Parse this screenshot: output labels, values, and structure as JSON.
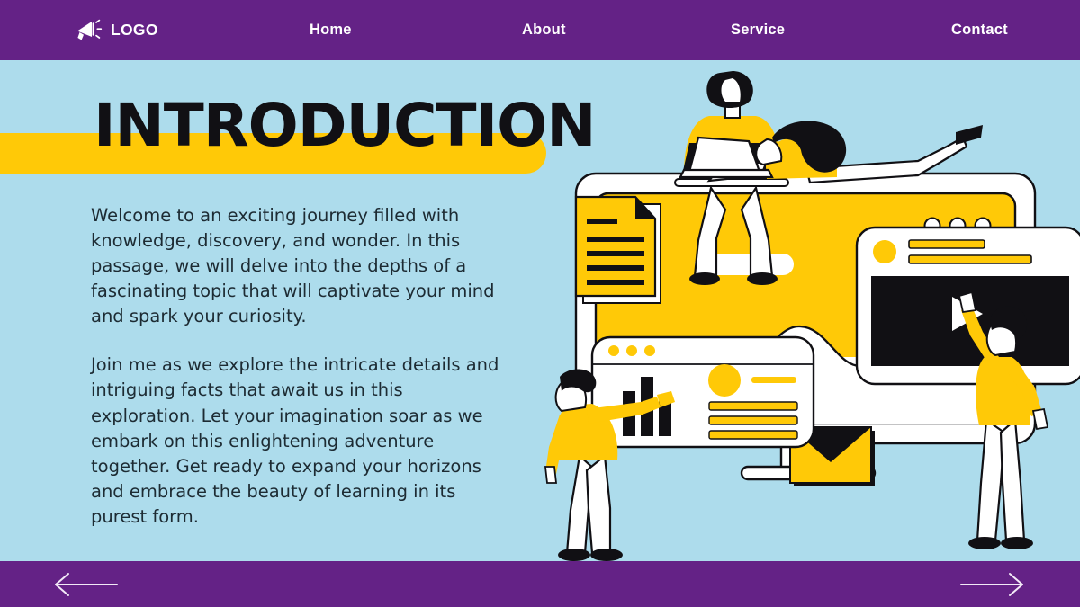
{
  "theme": {
    "purple": "#642286",
    "background_blue": "#addcec",
    "accent_yellow": "#ffc907",
    "ink_black": "#111014",
    "text_dark": "#1d2b33",
    "white": "#ffffff"
  },
  "navbar": {
    "logo": {
      "icon": "megaphone-icon",
      "label": "LOGO"
    },
    "items": [
      {
        "label": "Home"
      },
      {
        "label": "About"
      },
      {
        "label": "Service"
      },
      {
        "label": "Contact"
      }
    ]
  },
  "hero": {
    "title": "INTRODUCTION",
    "paragraphs": [
      "Welcome to an exciting journey filled with knowledge, discovery, and wonder. In this passage, we will delve into the depths of a fascinating topic that will captivate your mind and spark your curiosity.",
      "Join me as we explore the intricate details and intriguing facts that await us in this exploration. Let your imagination soar as we embark on this enlightening adventure together. Get ready to expand your horizons and embrace the beauty of learning in its purest form."
    ]
  },
  "illustration": {
    "description": "Flat-style illustration of people working with a large computer monitor, a video player window, a dashboard window with a bar chart, a document page and an envelope.",
    "elements": [
      {
        "name": "document-page-icon"
      },
      {
        "name": "large-monitor"
      },
      {
        "name": "monitor-wave-chart"
      },
      {
        "name": "monitor-dots"
      },
      {
        "name": "person-sitting-with-laptop"
      },
      {
        "name": "person-lying-with-laptop"
      },
      {
        "name": "video-player-window"
      },
      {
        "name": "play-button-icon"
      },
      {
        "name": "dashboard-window"
      },
      {
        "name": "bar-chart-icon"
      },
      {
        "name": "person-pointing-at-dashboard"
      },
      {
        "name": "person-reaching-up"
      },
      {
        "name": "envelope-icon"
      }
    ]
  },
  "footer": {
    "prev_label": "Previous slide",
    "next_label": "Next slide",
    "prev_icon": "arrow-left-icon",
    "next_icon": "arrow-right-icon"
  }
}
